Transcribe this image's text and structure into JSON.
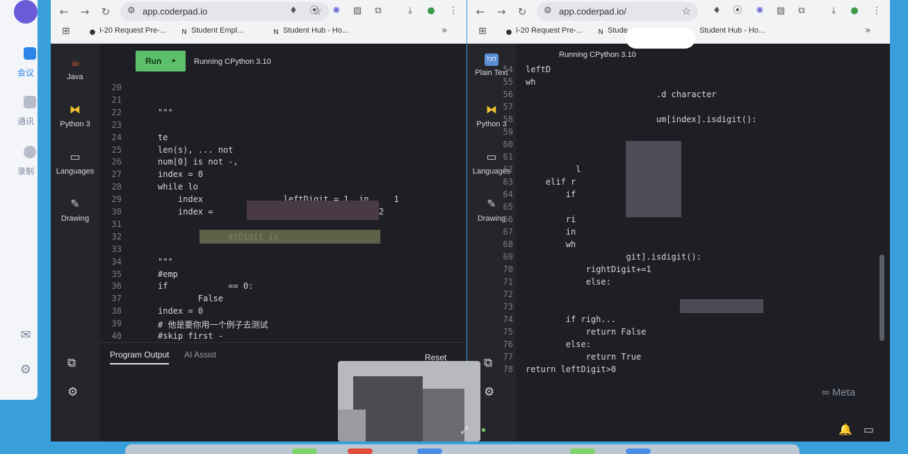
{
  "desktop_app": {
    "labels": [
      "会议",
      "通讯",
      "录制"
    ]
  },
  "left_window": {
    "url": "app.coderpad.io",
    "bookmarks": [
      "I-20 Request Pre-...",
      "Student Empl...",
      "Student Hub - Ho..."
    ],
    "sidebar": {
      "items": [
        {
          "label": "Java",
          "icon": "java-icon"
        },
        {
          "label": "Python 3",
          "icon": "python-icon"
        },
        {
          "label": "Languages",
          "icon": "terminal-icon"
        },
        {
          "label": "Drawing",
          "icon": "pen-icon"
        }
      ]
    },
    "run_label": "Run",
    "run_glyph": "▸",
    "status": "Running CPython 3.10",
    "code_lines": [
      {
        "n": "20",
        "t": ""
      },
      {
        "n": "21",
        "t": ""
      },
      {
        "n": "22",
        "t": "\"\"\""
      },
      {
        "n": "23",
        "t": ""
      },
      {
        "n": "24",
        "t": "te"
      },
      {
        "n": "25",
        "t": "len(s), ... not"
      },
      {
        "n": "26",
        "t": "num[0] is not -,"
      },
      {
        "n": "27",
        "t": "index = 0"
      },
      {
        "n": "28",
        "t": "while lo"
      },
      {
        "n": "29",
        "t": "    index                leftDigit = 1, in     1"
      },
      {
        "n": "30",
        "t": "    index =                     = 0   dex = 2"
      },
      {
        "n": "31",
        "t": ""
      },
      {
        "n": "32",
        "t": "              atDigit is"
      },
      {
        "n": "33",
        "t": ""
      },
      {
        "n": "34",
        "t": "\"\"\""
      },
      {
        "n": "35",
        "t": "#emp"
      },
      {
        "n": "36",
        "t": "if            == 0:"
      },
      {
        "n": "37",
        "t": "        False"
      },
      {
        "n": "38",
        "t": "index = 0"
      },
      {
        "n": "39",
        "t": "# 他是要你用一个例子去测试"
      },
      {
        "n": "40",
        "t": "#skip first -"
      }
    ],
    "bottom_tabs": [
      "Program Output",
      "AI Assist"
    ],
    "reset_label": "Reset"
  },
  "right_window": {
    "url": "app.coderpad.io/",
    "bookmarks": [
      "I-20 Request Pre-...",
      "Stude",
      "Student Hub - Ho..."
    ],
    "sidebar": {
      "items": [
        {
          "label": "Plain Text",
          "icon": "text-file-icon"
        },
        {
          "label": "Python 3",
          "icon": "python-icon"
        },
        {
          "label": "Languages",
          "icon": "terminal-icon"
        },
        {
          "label": "Drawing",
          "icon": "pen-icon"
        }
      ]
    },
    "status": "Running CPython 3.10",
    "code_lines": [
      {
        "n": "54",
        "t": "leftD"
      },
      {
        "n": "55",
        "t": "wh"
      },
      {
        "n": "56",
        "t": "                          .d character"
      },
      {
        "n": "57",
        "t": ""
      },
      {
        "n": "58",
        "t": "                          um[index].isdigit():"
      },
      {
        "n": "59",
        "t": ""
      },
      {
        "n": "60",
        "t": ""
      },
      {
        "n": "61",
        "t": ""
      },
      {
        "n": "62",
        "t": "          l"
      },
      {
        "n": "63",
        "t": "    elif r"
      },
      {
        "n": "64",
        "t": "        if                 ."
      },
      {
        "n": "65",
        "t": "                         se"
      },
      {
        "n": "66",
        "t": "        ri"
      },
      {
        "n": "67",
        "t": "        in"
      },
      {
        "n": "68",
        "t": "        wh"
      },
      {
        "n": "69",
        "t": "                    git].isdigit():"
      },
      {
        "n": "70",
        "t": "            rightDigit+=1"
      },
      {
        "n": "71",
        "t": "            else:"
      },
      {
        "n": "72",
        "t": ""
      },
      {
        "n": "73",
        "t": ""
      },
      {
        "n": "74",
        "t": "        if righ..."
      },
      {
        "n": "75",
        "t": "            return False"
      },
      {
        "n": "76",
        "t": "        else:"
      },
      {
        "n": "77",
        "t": "            return True"
      },
      {
        "n": "78",
        "t": "return leftDigit>0"
      }
    ],
    "watermark": "∞ Meta"
  }
}
